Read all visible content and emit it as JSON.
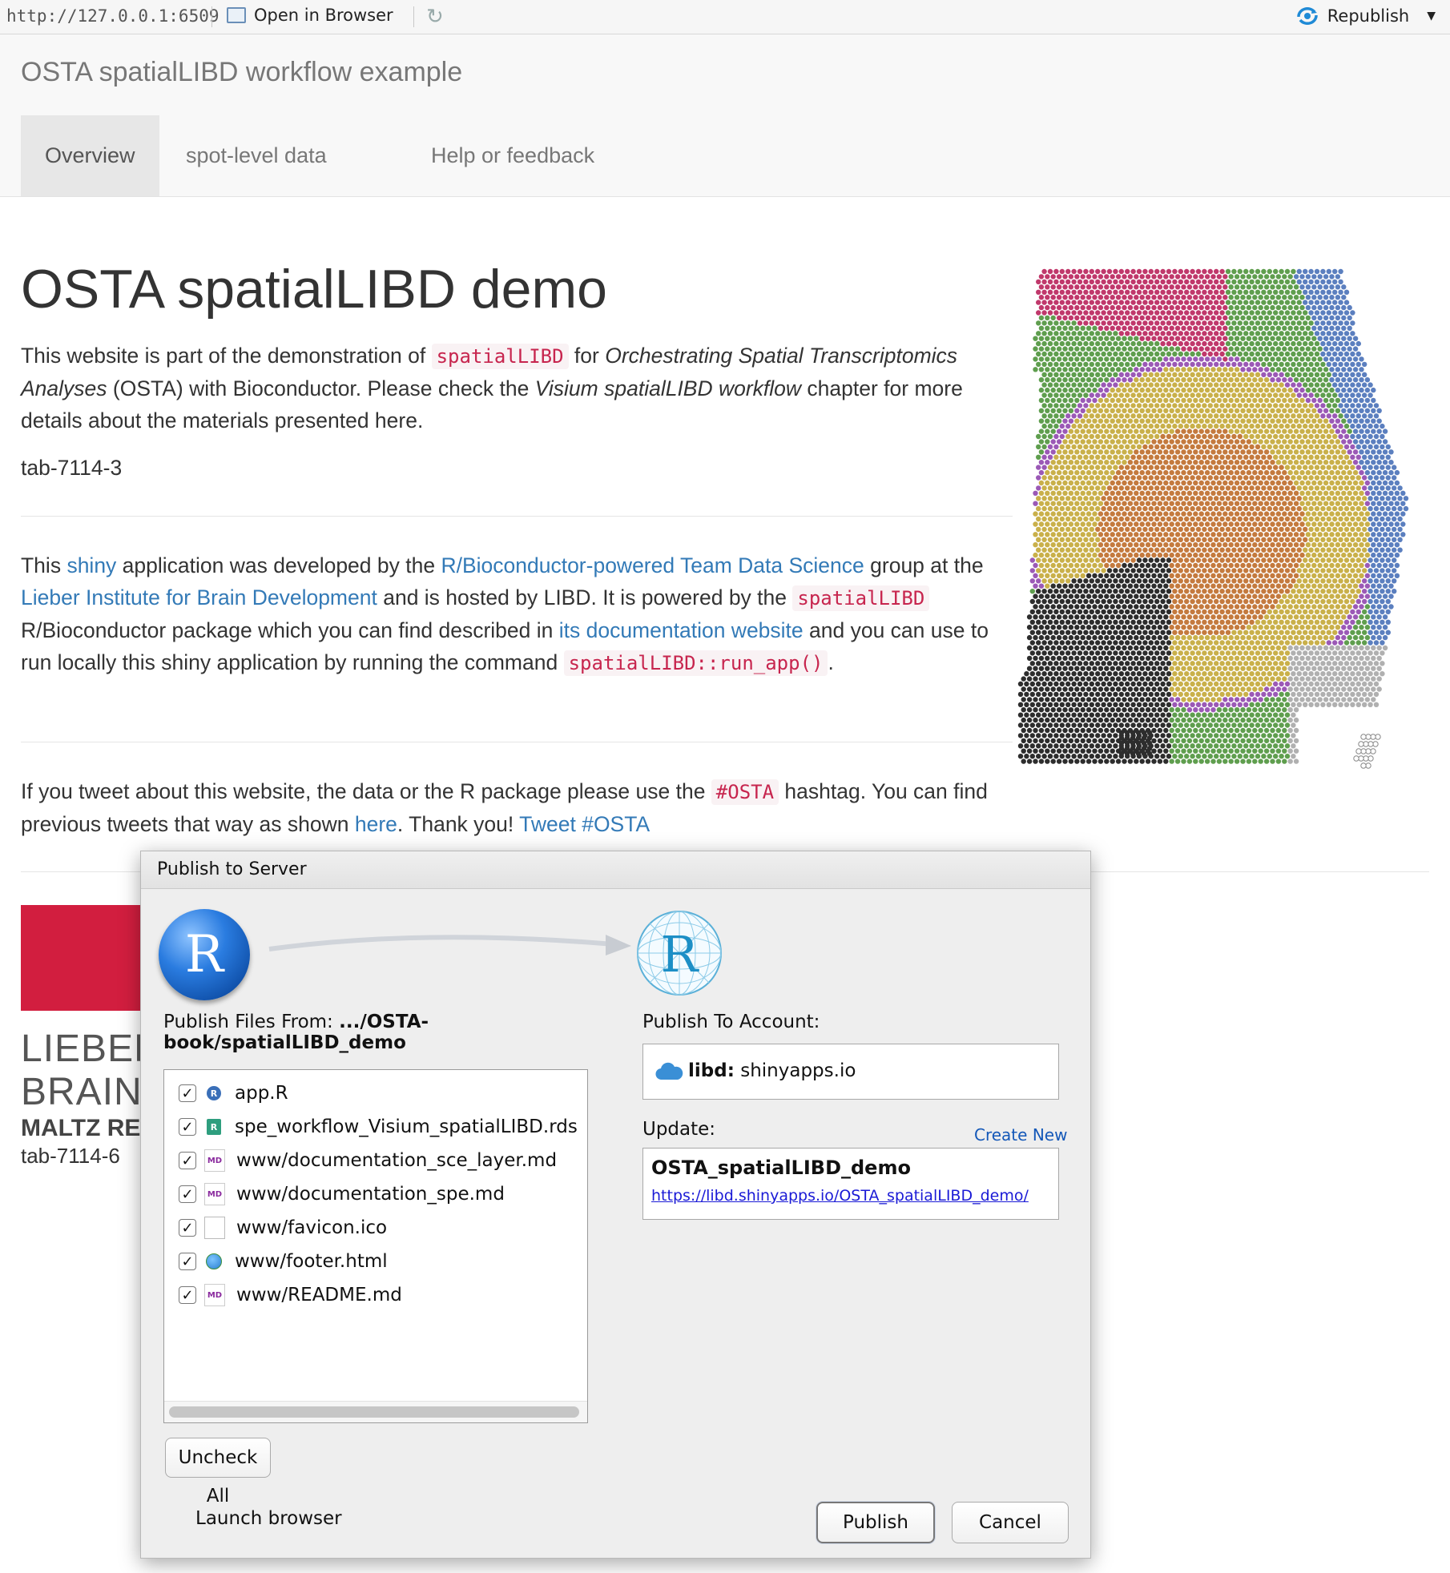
{
  "toolbar": {
    "url": "http://127.0.0.1:6509",
    "open_in_browser": "Open in Browser",
    "republish": "Republish",
    "icons": [
      "open-browser-icon",
      "refresh-icon",
      "republish-icon",
      "dropdown-caret-icon"
    ]
  },
  "navbar": {
    "brand": "OSTA spatialLIBD workflow example",
    "tabs": [
      {
        "label": "Overview",
        "active": true
      },
      {
        "label": "spot-level data",
        "active": false
      },
      {
        "label": "Help or feedback",
        "active": false
      }
    ]
  },
  "main": {
    "title": "OSTA spatialLIBD demo",
    "intro": {
      "t1": "This website is part of the demonstration of ",
      "code": "spatialLIBD",
      "t2": " for ",
      "em1": "Orchestrating Spatial Transcriptomics Analyses",
      "t3": " (OSTA) with Bioconductor. Please check the ",
      "em2": "Visium spatialLIBD workflow",
      "t4": " chapter for more details about the materials presented here."
    },
    "tab_id_1": "tab-7114-3",
    "para2": {
      "t1": "This ",
      "link_shiny": "shiny",
      "t2": " application was developed by the ",
      "link_tds": "R/Bioconductor-powered Team Data Science",
      "t3": " group at the ",
      "link_lieber": "Lieber Institute for Brain Development",
      "t4": " and is hosted by LIBD. It is powered by the ",
      "code1": "spatialLIBD",
      "t5": " R/Bioconductor package which you can find described in ",
      "link_docs": "its documentation website",
      "t6": " and you can use to run locally this shiny application by running the command ",
      "code2": "spatialLIBD::run_app()",
      "t7": "."
    },
    "para3": {
      "t1": "If you tweet about this website, the data or the R package please use the ",
      "code": "#OSTA",
      "t2": " hashtag. You can find previous tweets that way as shown ",
      "link_here": "here",
      "t3": ". Thank you! ",
      "link_tweet": "Tweet #OSTA"
    },
    "logo": {
      "line1": "LIEBER",
      "line2": "BRAIN",
      "line3": "MALTZ RES",
      "brand_color": "#d21e3f"
    },
    "tab_id_2": "tab-7114-6"
  },
  "dialog": {
    "title": "Publish to Server",
    "publish_from_label": "Publish Files From: ",
    "publish_from_path_1": ".../OSTA-",
    "publish_from_path_2": "book/spatialLIBD_demo",
    "files": [
      {
        "name": "app.R",
        "checked": true,
        "icon": "r-script-icon"
      },
      {
        "name": "spe_workflow_Visium_spatialLIBD.rds",
        "checked": true,
        "icon": "rds-file-icon"
      },
      {
        "name": "www/documentation_sce_layer.md",
        "checked": true,
        "icon": "markdown-file-icon"
      },
      {
        "name": "www/documentation_spe.md",
        "checked": true,
        "icon": "markdown-file-icon"
      },
      {
        "name": "www/favicon.ico",
        "checked": true,
        "icon": "blank-file-icon"
      },
      {
        "name": "www/footer.html",
        "checked": true,
        "icon": "html-file-icon"
      },
      {
        "name": "www/README.md",
        "checked": true,
        "icon": "markdown-file-icon"
      }
    ],
    "uncheck_all": "Uncheck All",
    "launch_browser": "Launch browser",
    "publish_to_label": "Publish To Account:",
    "account_name": "libd:",
    "account_server": "shinyapps.io",
    "update_label": "Update:",
    "create_new": "Create New",
    "app_name": "OSTA_spatialLIBD_demo",
    "app_url": "https://libd.shinyapps.io/OSTA_spatialLIBD_demo/",
    "publish_button": "Publish",
    "cancel_button": "Cancel"
  },
  "colors": {
    "link": "#337ab7",
    "code": "#c7254e",
    "layers": [
      "#c0386b",
      "#5b7fbf",
      "#5f9e4e",
      "#c9b04a",
      "#c47a3e",
      "#2d2d2d",
      "#9b59b6",
      "#b0b0b0"
    ]
  }
}
